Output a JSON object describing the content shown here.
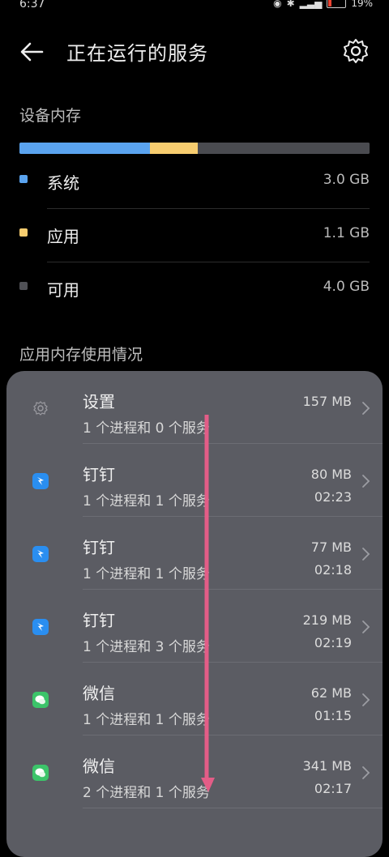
{
  "status": {
    "time": "6:37",
    "battery": "19%",
    "battery_level": 0.19
  },
  "header": {
    "title": "正在运行的服务"
  },
  "memory": {
    "section_title": "设备内存",
    "bar": [
      {
        "name": "系统",
        "fraction": 0.372,
        "color": "#5aa3ef"
      },
      {
        "name": "应用",
        "fraction": 0.137,
        "color": "#f7cd6f"
      },
      {
        "name": "可用",
        "fraction": 0.491,
        "color": "#4a4b50"
      }
    ],
    "legend": [
      {
        "label": "系统",
        "value": "3.0 GB",
        "color": "#5aa3ef"
      },
      {
        "label": "应用",
        "value": "1.1 GB",
        "color": "#f7cd6f"
      },
      {
        "label": "可用",
        "value": "4.0 GB",
        "color": "#505156"
      }
    ]
  },
  "app_usage": {
    "section_title": "应用内存使用情况",
    "apps": [
      {
        "name": "设置",
        "sub": "1 个进程和 0 个服务",
        "mem": "157 MB",
        "time": "",
        "icon": "settings-gear-icon",
        "color": "#9a9aa0"
      },
      {
        "name": "钉钉",
        "sub": "1 个进程和 1 个服务",
        "mem": "80 MB",
        "time": "02:23",
        "icon": "dingtalk-icon",
        "color": "#2a8ef0"
      },
      {
        "name": "钉钉",
        "sub": "1 个进程和 1 个服务",
        "mem": "77 MB",
        "time": "02:18",
        "icon": "dingtalk-icon",
        "color": "#2a8ef0"
      },
      {
        "name": "钉钉",
        "sub": "1 个进程和 3 个服务",
        "mem": "219 MB",
        "time": "02:19",
        "icon": "dingtalk-icon",
        "color": "#2a8ef0"
      },
      {
        "name": "微信",
        "sub": "1 个进程和 1 个服务",
        "mem": "62 MB",
        "time": "01:15",
        "icon": "wechat-icon",
        "color": "#3cc46a"
      },
      {
        "name": "微信",
        "sub": "2 个进程和 1 个服务",
        "mem": "341 MB",
        "time": "02:17",
        "icon": "wechat-icon",
        "color": "#3cc46a"
      }
    ]
  }
}
